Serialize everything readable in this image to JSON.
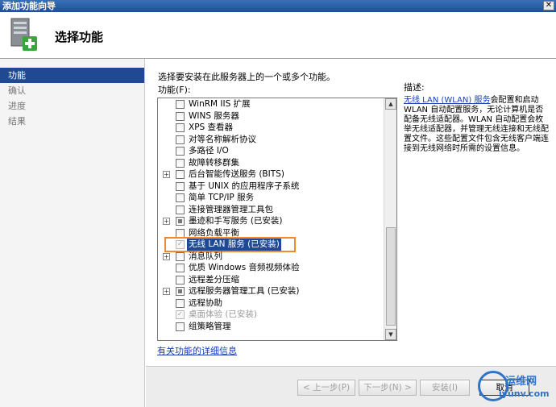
{
  "window": {
    "title": "添加功能向导",
    "close_label": "✕"
  },
  "header": {
    "title": "选择功能"
  },
  "nav": [
    {
      "label": "功能",
      "active": true
    },
    {
      "label": "确认",
      "active": false
    },
    {
      "label": "进度",
      "active": false
    },
    {
      "label": "结果",
      "active": false
    }
  ],
  "main": {
    "instruction": "选择要安装在此服务器上的一个或多个功能。",
    "features_label": "功能(F):",
    "features": [
      {
        "label": "WinRM IIS 扩展",
        "expander": false,
        "state": "unchecked"
      },
      {
        "label": "WINS 服务器",
        "expander": false,
        "state": "unchecked"
      },
      {
        "label": "XPS 查看器",
        "expander": false,
        "state": "unchecked"
      },
      {
        "label": "对等名称解析协议",
        "expander": false,
        "state": "unchecked"
      },
      {
        "label": "多路径 I/O",
        "expander": false,
        "state": "unchecked"
      },
      {
        "label": "故障转移群集",
        "expander": false,
        "state": "unchecked"
      },
      {
        "label": "后台智能传送服务 (BITS)",
        "expander": true,
        "state": "unchecked"
      },
      {
        "label": "基于 UNIX 的应用程序子系统",
        "expander": false,
        "state": "unchecked"
      },
      {
        "label": "简单 TCP/IP 服务",
        "expander": false,
        "state": "unchecked"
      },
      {
        "label": "连接管理器管理工具包",
        "expander": false,
        "state": "unchecked"
      },
      {
        "label": "墨迹和手写服务    (已安装)",
        "expander": true,
        "state": "partial"
      },
      {
        "label": "网络负载平衡",
        "expander": false,
        "state": "unchecked"
      },
      {
        "label": "无线 LAN 服务    (已安装)",
        "expander": false,
        "state": "checked-disabled",
        "selected": true
      },
      {
        "label": "消息队列",
        "expander": true,
        "state": "unchecked"
      },
      {
        "label": "优质 Windows 音频视频体验",
        "expander": false,
        "state": "unchecked"
      },
      {
        "label": "远程差分压缩",
        "expander": false,
        "state": "unchecked"
      },
      {
        "label": "远程服务器管理工具    (已安装)",
        "expander": true,
        "state": "partial"
      },
      {
        "label": "远程协助",
        "expander": false,
        "state": "unchecked"
      },
      {
        "label": "桌面体验    (已安装)",
        "expander": false,
        "state": "checked-disabled",
        "disabled": true
      },
      {
        "label": "组策略管理",
        "expander": false,
        "state": "unchecked"
      }
    ],
    "description_title": "描述:",
    "description_link": "无线 LAN (WLAN) 服务",
    "description_text": "会配置和启动 WLAN 自动配置服务，无论计算机是否配备无线适配器。WLAN 自动配置会枚举无线适配器，并管理无线连接和无线配置文件。这些配置文件包含无线客户端连接到无线网络时所需的设置信息。",
    "more_info_link": "有关功能的详细信息"
  },
  "footer": {
    "prev_label": "< 上一步(P)",
    "next_label": "下一步(N) >",
    "install_label": "安装(I)",
    "cancel_label": "取消"
  },
  "watermark": {
    "line1": "运维网",
    "line2": "iyunv.com"
  }
}
